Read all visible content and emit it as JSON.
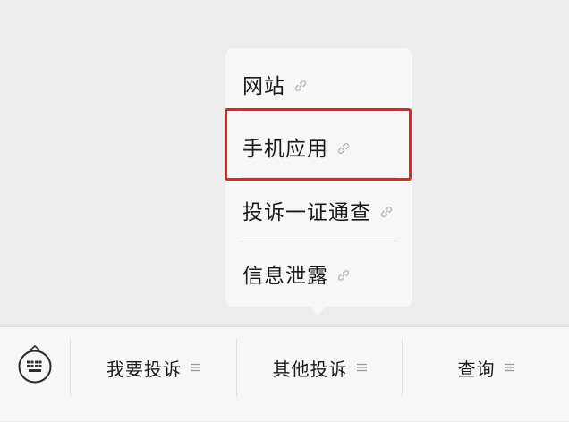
{
  "submenu": {
    "items": [
      {
        "label": "网站",
        "icon": "link-icon"
      },
      {
        "label": "手机应用",
        "icon": "link-icon"
      },
      {
        "label": "投诉一证通查",
        "icon": "link-icon"
      },
      {
        "label": "信息泄露",
        "icon": "link-icon"
      }
    ],
    "highlighted_item": "手机应用",
    "highlight_color": "#e2261e"
  },
  "bottom_menu": {
    "keyboard_icon": "keyboard-icon",
    "items": [
      {
        "label": "我要投诉",
        "icon": "menu-lines-icon"
      },
      {
        "label": "其他投诉",
        "icon": "menu-lines-icon"
      },
      {
        "label": "查询",
        "icon": "menu-lines-icon"
      }
    ]
  }
}
